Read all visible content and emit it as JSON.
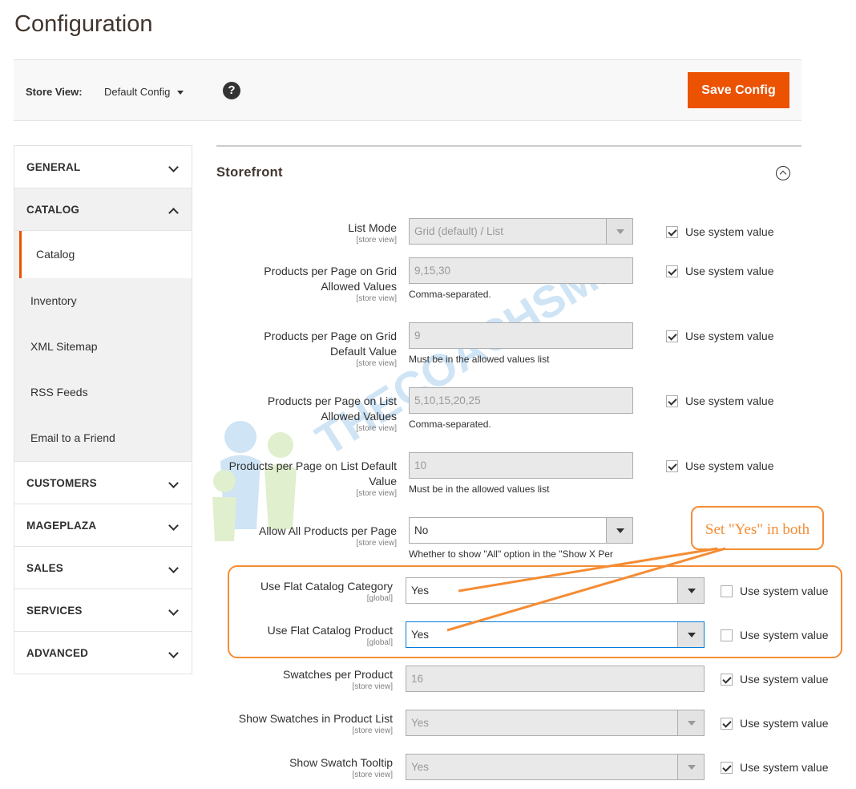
{
  "page": {
    "title": "Configuration"
  },
  "store_bar": {
    "label": "Store View:",
    "selected": "Default Config",
    "help_icon": "question-circle-icon",
    "save_label": "Save Config"
  },
  "sidebar": {
    "tabs": [
      {
        "label": "GENERAL",
        "icon": "chevron-down-icon"
      },
      {
        "label": "CATALOG",
        "icon": "chevron-up-icon",
        "expanded": true,
        "items": [
          "Catalog",
          "Inventory",
          "XML Sitemap",
          "RSS Feeds",
          "Email to a Friend"
        ],
        "active_item": "Catalog"
      },
      {
        "label": "CUSTOMERS",
        "icon": "chevron-down-icon"
      },
      {
        "label": "MAGEPLAZA",
        "icon": "chevron-down-icon"
      },
      {
        "label": "SALES",
        "icon": "chevron-down-icon"
      },
      {
        "label": "SERVICES",
        "icon": "chevron-down-icon"
      },
      {
        "label": "ADVANCED",
        "icon": "chevron-down-icon"
      }
    ]
  },
  "section": {
    "title": "Storefront",
    "icon": "collapse-up-icon",
    "use_system_label": "Use system value",
    "fields": [
      {
        "label": "List Mode",
        "scope": "[store view]",
        "value": "Grid (default) / List",
        "type": "select",
        "system": true
      },
      {
        "label": "Products per Page on Grid Allowed Values",
        "scope": "[store view]",
        "value": "9,15,30",
        "type": "text",
        "note": "Comma-separated.",
        "system": true
      },
      {
        "label": "Products per Page on Grid Default Value",
        "scope": "[store view]",
        "value": "9",
        "type": "text",
        "note": "Must be in the allowed values list",
        "system": true
      },
      {
        "label": "Products per Page on List Allowed Values",
        "scope": "[store view]",
        "value": "5,10,15,20,25",
        "type": "text",
        "note": "Comma-separated.",
        "system": true
      },
      {
        "label": "Products per Page on List Default Value",
        "scope": "[store view]",
        "value": "10",
        "type": "text",
        "note": "Must be in the allowed values list",
        "system": true
      },
      {
        "label": "Allow All Products per Page",
        "scope": "[store view]",
        "value": "No",
        "type": "select",
        "note": "Whether to show \"All\" option in the \"Show X Per",
        "enabled": true
      },
      {
        "label": "Use Flat Catalog Category",
        "scope": "[global]",
        "value": "Yes",
        "type": "select",
        "enabled": true,
        "system": false
      },
      {
        "label": "Use Flat Catalog Product",
        "scope": "[global]",
        "value": "Yes",
        "type": "select",
        "enabled": true,
        "system": false
      },
      {
        "label": "Swatches per Product",
        "scope": "[store view]",
        "value": "16",
        "type": "text",
        "system": true
      },
      {
        "label": "Show Swatches in Product List",
        "scope": "[store view]",
        "value": "Yes",
        "type": "select",
        "system": true
      },
      {
        "label": "Show Swatch Tooltip",
        "scope": "[store view]",
        "value": "Yes",
        "type": "select",
        "system": true
      }
    ]
  },
  "annotation": {
    "callout": "Set \"Yes\" in both",
    "color": "#f58c34"
  },
  "watermark": {
    "text": "THECOACHSMB"
  },
  "colors": {
    "accent": "#eb5202",
    "annotation": "#f58c34"
  }
}
